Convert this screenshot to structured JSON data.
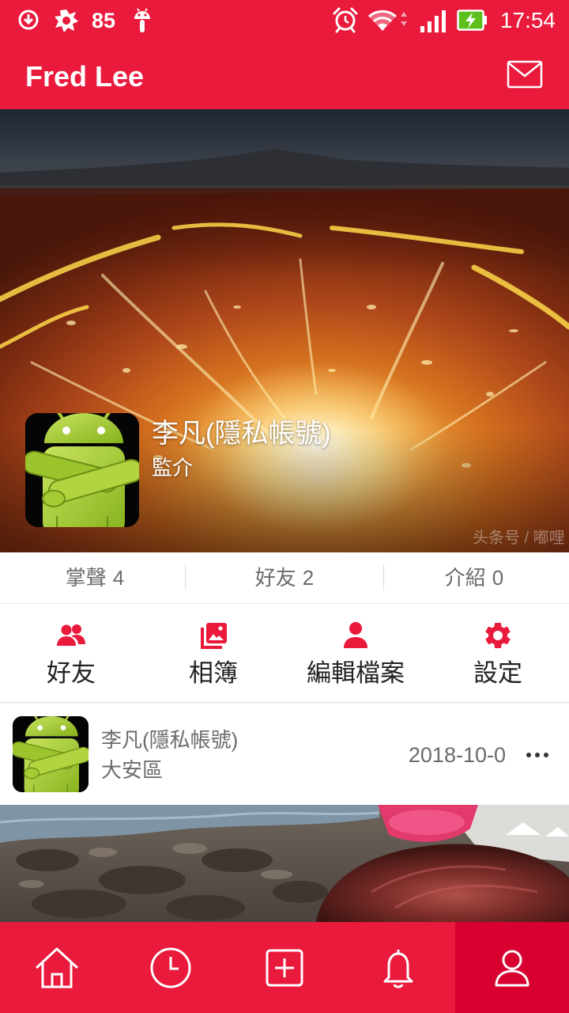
{
  "status_bar": {
    "notification_count": "85",
    "time": "17:54",
    "left_icons": [
      "download-icon",
      "splat-icon",
      "android-icon"
    ],
    "right_icons": [
      "alarm-icon",
      "wifi-icon",
      "signal-icon",
      "battery-charging-icon"
    ]
  },
  "app_bar": {
    "title": "Fred Lee",
    "action_icon": "mail-icon"
  },
  "profile": {
    "name": "李凡(隱私帳號)",
    "bio": "監介",
    "watermark": "头条号 / 嘟哩"
  },
  "stats": [
    {
      "label": "掌聲",
      "count": "4"
    },
    {
      "label": "好友",
      "count": "2"
    },
    {
      "label": "介紹",
      "count": "0"
    }
  ],
  "actions": [
    {
      "label": "好友",
      "icon": "friends-icon"
    },
    {
      "label": "相簿",
      "icon": "album-icon"
    },
    {
      "label": "編輯檔案",
      "icon": "edit-profile-icon"
    },
    {
      "label": "設定",
      "icon": "settings-icon"
    }
  ],
  "post": {
    "author": "李凡(隱私帳號)",
    "location": "大安區",
    "date": "2018-10-0",
    "more_icon": "more-icon"
  },
  "bottom_nav": {
    "items": [
      {
        "icon": "home-icon"
      },
      {
        "icon": "history-icon"
      },
      {
        "icon": "add-icon"
      },
      {
        "icon": "notifications-icon"
      },
      {
        "icon": "profile-icon"
      }
    ],
    "active_index": 4
  },
  "colors": {
    "primary": "#e91a3c",
    "primary_active": "#d80030",
    "text_primary": "#222222",
    "text_secondary": "#6b6b6b",
    "divider": "#e6e6e6"
  }
}
